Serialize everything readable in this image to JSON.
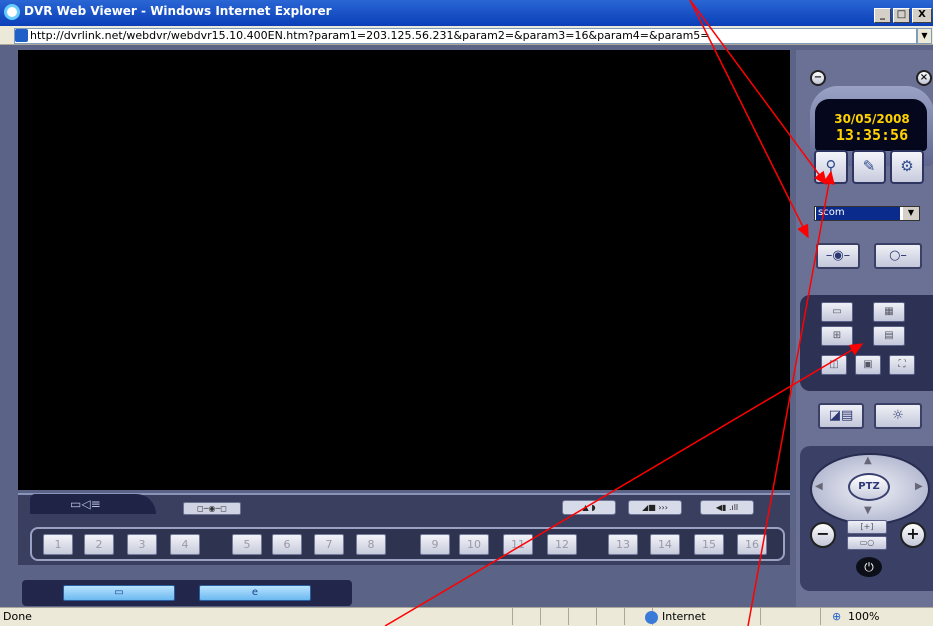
{
  "window": {
    "title": "DVR Web Viewer - Windows Internet Explorer",
    "min": "_",
    "max": "□",
    "close": "X"
  },
  "address": {
    "url": "http://dvrlink.net/webdvr/webdvr15.10.400EN.htm?param1=203.125.56.231&param2=&param3=16&param4=&param5="
  },
  "viewer": {
    "date": "30/05/2008",
    "time": "13:35:56",
    "camera_select": "scom",
    "channels": [
      "1",
      "2",
      "3",
      "4",
      "5",
      "6",
      "7",
      "8",
      "9",
      "10",
      "11",
      "12",
      "13",
      "14",
      "15",
      "16"
    ],
    "ptz_label": "PTZ"
  },
  "status": {
    "text": "Done",
    "zone": "Internet",
    "zoom": "100%"
  },
  "colors": {
    "annotation_arrows": "#ff0000",
    "clock_digits": "#ffd200"
  }
}
